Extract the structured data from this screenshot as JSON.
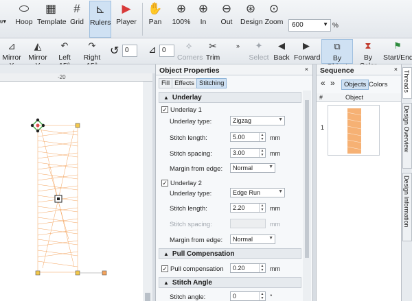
{
  "toolbar_top": {
    "items": [
      {
        "name": "hoop-button",
        "label": "Hoop"
      },
      {
        "name": "template-button",
        "label": "Template"
      },
      {
        "name": "grid-button",
        "label": "Grid"
      },
      {
        "name": "rulers-button",
        "label": "Rulers"
      },
      {
        "name": "player-button",
        "label": "Player"
      },
      {
        "name": "pan-button",
        "label": "Pan"
      },
      {
        "name": "zoom-100-button",
        "label": "100%"
      },
      {
        "name": "zoom-in-button",
        "label": "In"
      },
      {
        "name": "zoom-out-button",
        "label": "Out"
      },
      {
        "name": "zoom-design-button",
        "label": "Design"
      },
      {
        "name": "zoom-button",
        "label": "Zoom"
      }
    ],
    "zoom_value": "600",
    "zoom_unit": "%"
  },
  "toolbar_second": {
    "items": [
      {
        "name": "mirror-x-button",
        "label": "Mirror X"
      },
      {
        "name": "mirror-y-button",
        "label": "Mirror Y"
      },
      {
        "name": "rotate-left-button",
        "label": "Left 15°"
      },
      {
        "name": "rotate-right-button",
        "label": "Right 15°"
      },
      {
        "name": "corners-button",
        "label": "Corners"
      },
      {
        "name": "trim-button",
        "label": "Trim"
      },
      {
        "name": "select-button",
        "label": "Select"
      },
      {
        "name": "back-button",
        "label": "Back"
      },
      {
        "name": "forward-button",
        "label": "Forward"
      },
      {
        "name": "by-object-button",
        "label": "By Object"
      },
      {
        "name": "by-color-button",
        "label": "By Color"
      },
      {
        "name": "start-end-button",
        "label": "Start/End"
      }
    ],
    "rotate_value": "0",
    "slant_value": "0"
  },
  "ruler": {
    "tick_label": "-20"
  },
  "object_properties": {
    "title": "Object Properties",
    "tabs": [
      "Fill",
      "Effects",
      "Stitching"
    ],
    "underlay_section": "Underlay",
    "underlay1": {
      "label": "Underlay 1",
      "type_label": "Underlay type:",
      "type_value": "Zigzag",
      "length_label": "Stitch length:",
      "length_value": "5.00",
      "spacing_label": "Stitch spacing:",
      "spacing_value": "3.00",
      "margin_label": "Margin from edge:",
      "margin_value": "Normal",
      "unit": "mm"
    },
    "underlay2": {
      "label": "Underlay 2",
      "type_label": "Underlay type:",
      "type_value": "Edge Run",
      "length_label": "Stitch length:",
      "length_value": "2.20",
      "spacing_label": "Stitch spacing:",
      "spacing_value": "",
      "margin_label": "Margin from edge:",
      "margin_value": "Normal",
      "unit": "mm"
    },
    "pull_section": "Pull Compensation",
    "pull_label": "Pull compensation",
    "pull_value": "0.20",
    "pull_unit": "mm",
    "angle_section": "Stitch Angle",
    "angle_label": "Stitch angle:",
    "angle_value": "0",
    "angle_unit": "°"
  },
  "sequence": {
    "title": "Sequence",
    "mode_objects": "Objects",
    "mode_colors": "Colors",
    "col_num": "#",
    "col_object": "Object",
    "rows": [
      {
        "num": "1"
      }
    ]
  },
  "side_tabs": [
    "Threads",
    "Design Overview",
    "Design Information"
  ],
  "colors": {
    "stitch": "#f4a35c",
    "accent": "#cfe1f3"
  }
}
